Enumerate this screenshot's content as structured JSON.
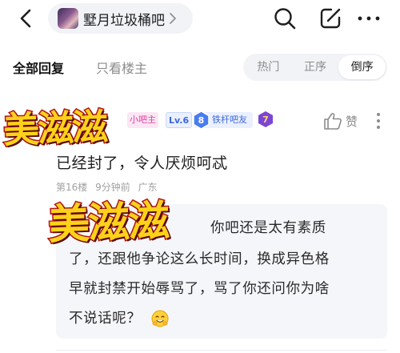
{
  "header": {
    "forum_name": "墅月垃圾桶吧"
  },
  "tabs": {
    "all_replies": "全部回复",
    "owner_only": "只看楼主",
    "sort": [
      "热门",
      "正序",
      "倒序"
    ],
    "sort_selected": "倒序"
  },
  "watermark": "美滋滋",
  "comment": {
    "badges": {
      "role": "小吧主",
      "level": "Lv.6",
      "fan_level": "8",
      "fan_title": "铁杆吧友",
      "purple_num": "7"
    },
    "like_label": "赞",
    "text": "已经封了，令人厌烦呵忒",
    "meta": {
      "floor": "第16楼",
      "time": "9分钟前",
      "location": "广东"
    },
    "reply_lines": [
      "你吧还是太有素质",
      "了，还跟他争论这么长时间，换成异色格",
      "早就封禁开始辱骂了，骂了你还问你为啥",
      "不说话呢？"
    ]
  },
  "colors": {
    "accent_pink": "#e0409d",
    "accent_blue": "#3b67d8",
    "sticker_yellow": "#ffd21a",
    "sticker_red": "#b51414"
  }
}
